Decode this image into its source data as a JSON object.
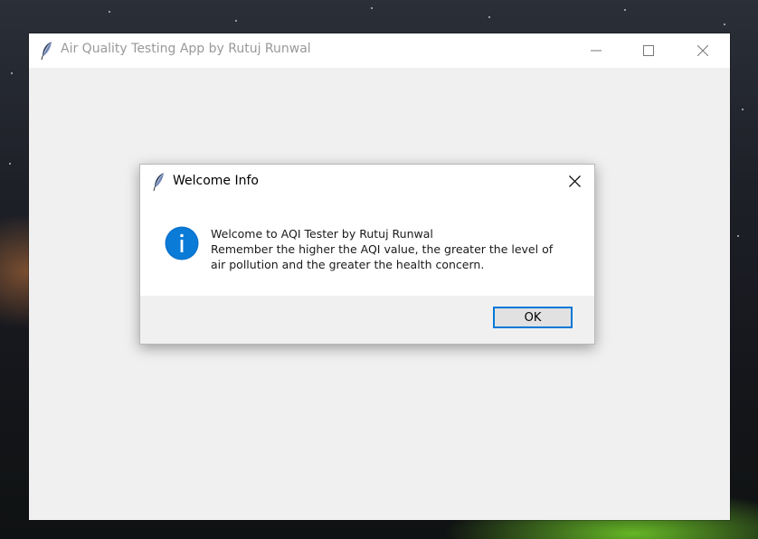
{
  "main_window": {
    "title": "Air Quality Testing App by Rutuj Runwal",
    "icon": "feather-icon",
    "controls": {
      "minimize": "minimize-icon",
      "maximize": "maximize-icon",
      "close": "close-icon"
    }
  },
  "dialog": {
    "title": "Welcome Info",
    "icon": "feather-icon",
    "status_icon": "info-icon",
    "message_lines": [
      "Welcome to AQI Tester by Rutuj Runwal",
      "Remember the higher the AQI value, the greater the level of",
      "air pollution and the greater the health concern."
    ],
    "ok_label": "OK"
  },
  "colors": {
    "accent": "#0078d7",
    "window_bg": "#f0f0f0",
    "titlebar_bg": "#ffffff",
    "inactive_title_text": "#999999"
  }
}
